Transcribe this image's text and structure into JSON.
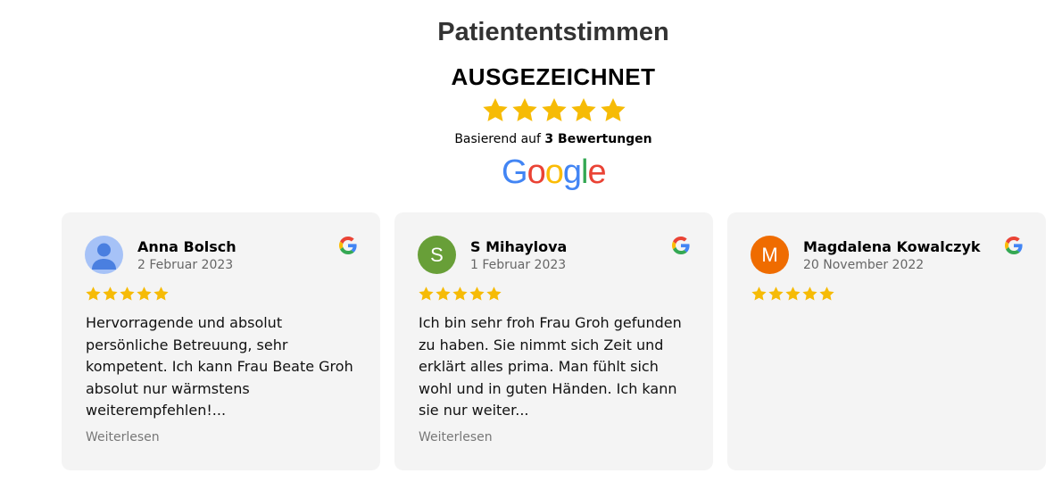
{
  "header": {
    "title": "Patiententstimmen",
    "rating_label": "AUSGEZEICHNET",
    "summary_stars": 5,
    "basis_prefix": "Basierend auf ",
    "basis_count": "3 Bewertungen",
    "provider_logo": "Google",
    "star_color": "#f6bb06"
  },
  "reviews": [
    {
      "name": "Anna Bolsch",
      "date": "2 Februar 2023",
      "stars": 5,
      "avatar": {
        "type": "person-icon",
        "bg": "#a6c2f7",
        "fg": "#4a7fe0"
      },
      "text": "Hervorragende und absolut persönliche Betreuung, sehr kompetent. Ich kann Frau Beate Groh absolut nur wärmstens weiterempfehlen!...",
      "read_more": "Weiterlesen"
    },
    {
      "name": "S Mihaylova",
      "date": "1 Februar 2023",
      "stars": 5,
      "avatar": {
        "type": "initial",
        "letter": "S",
        "bg": "#689f38"
      },
      "text": "Ich bin sehr froh Frau Groh gefunden zu haben. Sie nimmt sich Zeit und erklärt alles prima. Man fühlt sich wohl und in guten Händen. Ich kann sie nur weiter...",
      "read_more": "Weiterlesen"
    },
    {
      "name": "Magdalena Kowalczyk",
      "date": "20 November 2022",
      "stars": 5,
      "avatar": {
        "type": "initial",
        "letter": "M",
        "bg": "#ef6c00"
      },
      "text": "",
      "read_more": ""
    }
  ]
}
